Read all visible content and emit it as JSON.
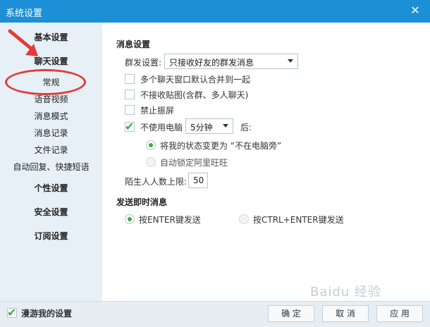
{
  "window": {
    "title": "系统设置",
    "close_icon": "close-icon"
  },
  "sidebar": {
    "items": [
      {
        "label": "基本设置"
      },
      {
        "label": "聊天设置"
      },
      {
        "label": "常规"
      },
      {
        "label": "语音视频"
      },
      {
        "label": "消息模式"
      },
      {
        "label": "消息记录"
      },
      {
        "label": "文件记录"
      },
      {
        "label": "自动回复、快捷短语"
      },
      {
        "label": "个性设置"
      },
      {
        "label": "安全设置"
      },
      {
        "label": "订阅设置"
      }
    ],
    "selected": "聊天设置"
  },
  "message_settings": {
    "title": "消息设置",
    "group_label": "群发设置:",
    "group_value": "只接收好友的群发消息",
    "opt_merge": "多个聊天窗口默认合并到一起",
    "opt_no_paste": "不接收贴图(含群、多人聊天)",
    "opt_no_shake": "禁止振屏",
    "idle_prefix": "不使用电脑",
    "idle_value": "5分钟",
    "idle_suffix": "后:",
    "radio_status": "将我的状态变更为 “不在电脑旁”",
    "radio_lock": "自动锁定阿里旺旺",
    "stranger_label": "陌生人人数上限:",
    "stranger_value": "50"
  },
  "send_settings": {
    "title": "发送即时消息",
    "radio_enter": "按ENTER键发送",
    "radio_ctrl_enter": "按CTRL+ENTER键发送"
  },
  "footer": {
    "roaming_label": "漫游我的设置",
    "ok": "确 定",
    "cancel": "取 消",
    "apply": "应 用"
  },
  "annotation": {
    "color": "#e23b3b"
  },
  "watermark": "Baidu 经验",
  "colors": {
    "titlebar": "#1c8fd6",
    "check": "#3ea94b"
  }
}
